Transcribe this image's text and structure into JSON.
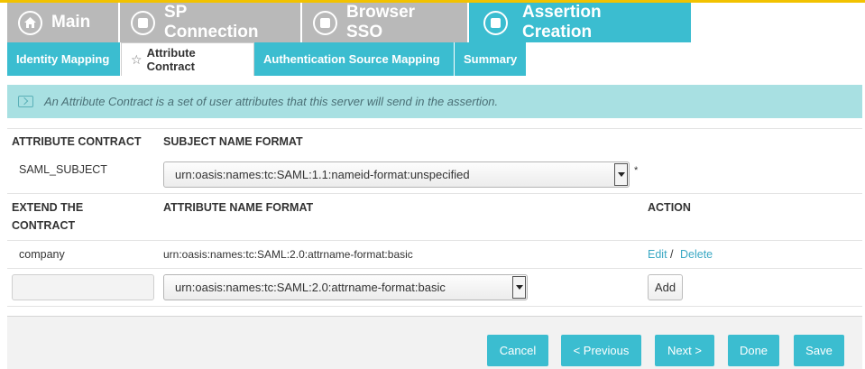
{
  "main_tabs": [
    {
      "label": "Main",
      "icon": "home-icon",
      "active": false
    },
    {
      "label": "SP Connection",
      "icon": "square-circle-icon",
      "active": false
    },
    {
      "label": "Browser SSO",
      "icon": "square-circle-icon",
      "active": false
    },
    {
      "label": "Assertion Creation",
      "icon": "square-circle-icon",
      "active": true
    }
  ],
  "sub_tabs": [
    {
      "label": "Identity Mapping",
      "active": false
    },
    {
      "label": "Attribute Contract",
      "active": true
    },
    {
      "label": "Authentication Source Mapping",
      "active": false
    },
    {
      "label": "Summary",
      "active": false
    }
  ],
  "info": {
    "text": "An Attribute Contract is a set of user attributes that this server will send in the assertion.",
    "icon": "expand-icon"
  },
  "table1": {
    "col1": "ATTRIBUTE CONTRACT",
    "col2": "SUBJECT NAME FORMAT",
    "row_name": "SAML_SUBJECT",
    "row_format": "urn:oasis:names:tc:SAML:1.1:nameid-format:unspecified",
    "required_mark": "*"
  },
  "table2": {
    "col1_line1": "EXTEND THE",
    "col1_line2": "CONTRACT",
    "col2": "ATTRIBUTE NAME FORMAT",
    "col3": "ACTION",
    "rows": [
      {
        "name": "company",
        "format": "urn:oasis:names:tc:SAML:2.0:attrname-format:basic",
        "edit": "Edit",
        "sep": "/",
        "delete": "Delete"
      }
    ],
    "new_row": {
      "name_value": "",
      "format": "urn:oasis:names:tc:SAML:2.0:attrname-format:basic",
      "add": "Add"
    }
  },
  "footer": {
    "cancel": "Cancel",
    "previous": "< Previous",
    "next": "Next >",
    "done": "Done",
    "save": "Save"
  },
  "colors": {
    "accent": "#3bbdd0",
    "inactive_tab": "#b9b9b9",
    "info_bg": "#a8e0e2",
    "top_strip": "#f2c200",
    "link": "#3aa8c4"
  }
}
